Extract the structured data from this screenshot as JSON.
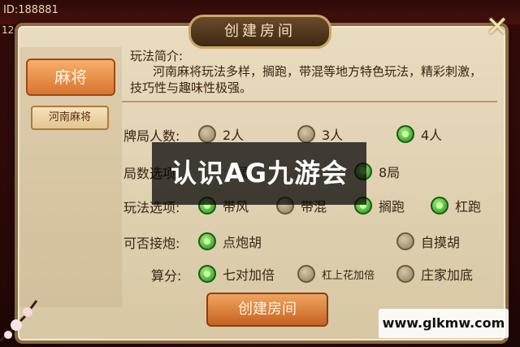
{
  "top": {
    "id_text": "ID:188881",
    "side_num": "12"
  },
  "dialog": {
    "title": "创建房间",
    "close_icon": "close-icon",
    "left_menu": {
      "mahjong_label": "麻将",
      "variant_label": "河南麻将"
    },
    "intro": {
      "heading": "玩法简介:",
      "body": "河南麻将玩法多样，搁跑，带混等地方特色玩法，精彩刺激，技巧性与趣味性极强。"
    },
    "rows": [
      {
        "label": "牌局人数:",
        "options": [
          {
            "label": "2人",
            "selected": false
          },
          {
            "label": "3人",
            "selected": false
          },
          {
            "label": "4人",
            "selected": true
          }
        ]
      },
      {
        "label": "局数选项",
        "options": [
          {
            "label": "局",
            "selected": false
          },
          {
            "label": "8局",
            "selected": true
          }
        ]
      },
      {
        "label": "玩法选项:",
        "options": [
          {
            "label": "带风",
            "selected": true
          },
          {
            "label": "带混",
            "selected": false
          },
          {
            "label": "搁跑",
            "selected": true
          },
          {
            "label": "杠跑",
            "selected": true
          }
        ]
      },
      {
        "label": "可否接炮:",
        "options": [
          {
            "label": "点炮胡",
            "selected": true
          },
          {
            "label": "自摸胡",
            "selected": false
          }
        ]
      },
      {
        "label": "算分:",
        "options": [
          {
            "label": "七对加倍",
            "selected": true
          },
          {
            "label": "杠上花加倍",
            "selected": false
          },
          {
            "label": "庄家加底",
            "selected": false
          }
        ]
      }
    ],
    "create_button": "创建房间"
  },
  "overlay_text": "认识AG九游会",
  "watermark": "www.glkmw.com",
  "colors": {
    "accent": "#d8742f",
    "selected_radio": "#1c8f1c",
    "panel": "#e9dcc0"
  }
}
